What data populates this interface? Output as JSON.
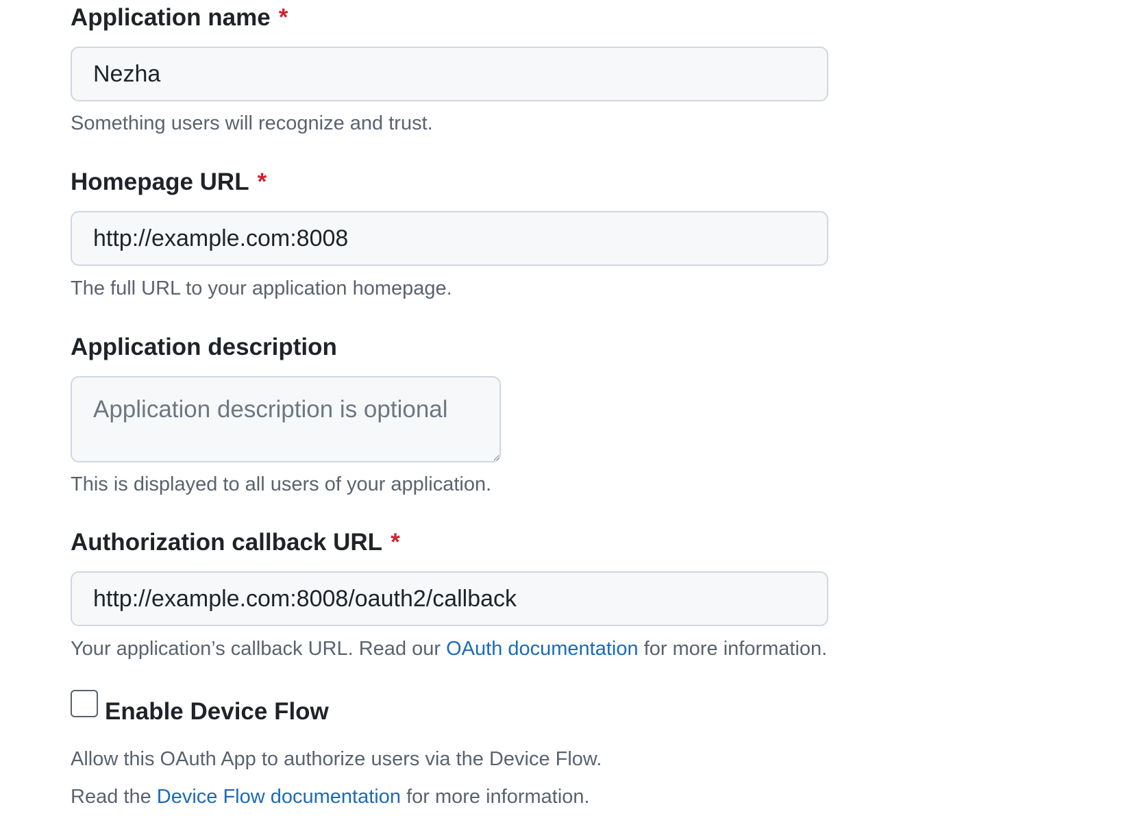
{
  "fields": {
    "app_name": {
      "label": "Application name",
      "required_mark": "*",
      "value": "Nezha",
      "note": "Something users will recognize and trust."
    },
    "homepage_url": {
      "label": "Homepage URL",
      "required_mark": "*",
      "value": "http://example.com:8008",
      "note": "The full URL to your application homepage."
    },
    "description": {
      "label": "Application description",
      "placeholder": "Application description is optional",
      "note": "This is displayed to all users of your application."
    },
    "callback_url": {
      "label": "Authorization callback URL",
      "required_mark": "*",
      "value": "http://example.com:8008/oauth2/callback",
      "note_before": "Your application’s callback URL. Read our",
      "note_link": "OAuth documentation",
      "note_after": "for more information."
    }
  },
  "device_flow": {
    "label": "Enable Device Flow",
    "checked": false,
    "note1": "Allow this OAuth App to authorize users via the Device Flow.",
    "note2_before": "Read the",
    "note2_link": "Device Flow documentation",
    "note2_after": "for more information."
  },
  "colors": {
    "required": "#cf222e",
    "link": "#1a6bb8",
    "muted_text": "#59636e",
    "input_bg": "#f6f8fa",
    "input_border": "#d0d7de"
  }
}
